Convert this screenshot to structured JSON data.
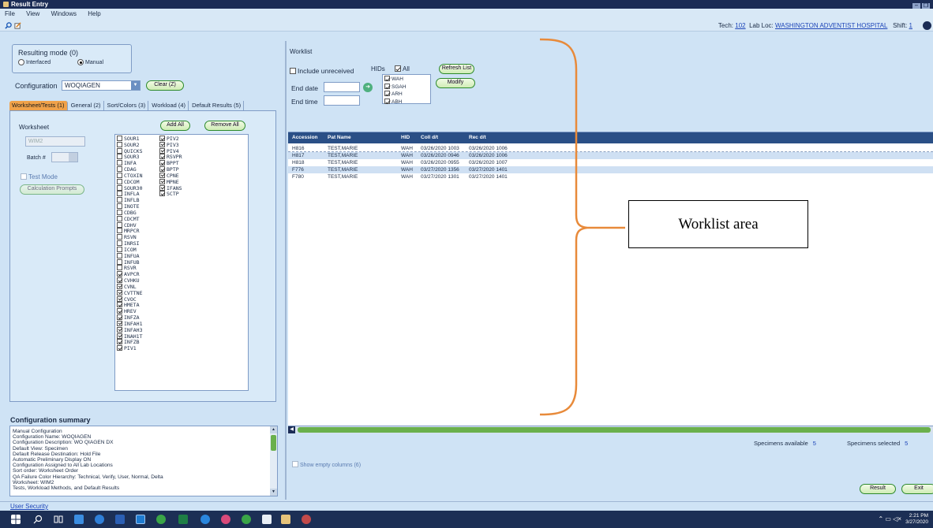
{
  "window": {
    "title": "Result Entry"
  },
  "menu": [
    "File",
    "View",
    "Windows",
    "Help"
  ],
  "toolbar": {
    "tech_label": "Tech:",
    "tech_value": "102",
    "lab_label": "Lab Loc:",
    "lab_value": "WASHINGTON ADVENTIST HOSPITAL",
    "shift_label": "Shift:",
    "shift_value": "1"
  },
  "resulting_mode": {
    "title": "Resulting mode (0)",
    "options": [
      "Interfaced",
      "Manual"
    ],
    "selected": "Manual"
  },
  "configuration": {
    "label": "Configuration",
    "value": "WOQIAGEN",
    "clear_label": "Clear (Z)"
  },
  "tabs": [
    "Worksheet/Tests (1)",
    "General (2)",
    "Sort/Colors (3)",
    "Workload (4)",
    "Default Results (5)"
  ],
  "worksheet": {
    "label": "Worksheet",
    "value": "WIM2",
    "batch_label": "Batch #",
    "test_mode_label": "Test Mode",
    "calc_label": "Calculation Prompts",
    "add_all_label": "Add All",
    "remove_all_label": "Remove All"
  },
  "tests_col1": [
    {
      "name": "SOUR1",
      "checked": false
    },
    {
      "name": "SOUR2",
      "checked": false
    },
    {
      "name": "QUICKS",
      "checked": false
    },
    {
      "name": "SOUR3",
      "checked": false
    },
    {
      "name": "INFA",
      "checked": false
    },
    {
      "name": "CDAG",
      "checked": false
    },
    {
      "name": "CTOXIN",
      "checked": false
    },
    {
      "name": "CDCOM",
      "checked": false
    },
    {
      "name": "SOUR30",
      "checked": false
    },
    {
      "name": "INFLA",
      "checked": false
    },
    {
      "name": "INFLB",
      "checked": false
    },
    {
      "name": "INOTE",
      "checked": false
    },
    {
      "name": "CDBG",
      "checked": false
    },
    {
      "name": "CDCMT",
      "checked": false
    },
    {
      "name": "CDHV",
      "checked": false
    },
    {
      "name": "MRPCR",
      "checked": false
    },
    {
      "name": "RSVN",
      "checked": false
    },
    {
      "name": "INRSI",
      "checked": false
    },
    {
      "name": "ICOM",
      "checked": false
    },
    {
      "name": "INFUA",
      "checked": false
    },
    {
      "name": "INFUB",
      "checked": false
    },
    {
      "name": "RSVR",
      "checked": false
    },
    {
      "name": "AVPCR",
      "checked": true
    },
    {
      "name": "CVHKU",
      "checked": true
    },
    {
      "name": "CVNL",
      "checked": true
    },
    {
      "name": "CVTTNE",
      "checked": true
    },
    {
      "name": "CVOC",
      "checked": true
    },
    {
      "name": "HMETA",
      "checked": true
    },
    {
      "name": "HREV",
      "checked": true
    },
    {
      "name": "INFZA",
      "checked": true
    },
    {
      "name": "INFAH1",
      "checked": true
    },
    {
      "name": "INFAH3",
      "checked": true
    },
    {
      "name": "INAH1T",
      "checked": true
    },
    {
      "name": "INFZB",
      "checked": true
    },
    {
      "name": "PIV1",
      "checked": true
    }
  ],
  "tests_col2": [
    {
      "name": "PIV2",
      "checked": true
    },
    {
      "name": "PIV3",
      "checked": true
    },
    {
      "name": "PIV4",
      "checked": true
    },
    {
      "name": "RSVPR",
      "checked": true
    },
    {
      "name": "BPPT",
      "checked": true
    },
    {
      "name": "BPTP",
      "checked": true
    },
    {
      "name": "CPNE",
      "checked": true
    },
    {
      "name": "MPNE",
      "checked": true
    },
    {
      "name": "IFANS",
      "checked": true
    },
    {
      "name": "SCTP",
      "checked": true
    }
  ],
  "summary": {
    "title": "Configuration summary",
    "lines": [
      "Manual Configuration",
      "Configuration Name: WOQIAGEN",
      "Configuration Description: WO QIAGEN DX",
      "Default View: Specimen",
      "Default Release Destination: Hold File",
      "Automatic Preliminary Display ON",
      "Configuration Assigned to All Lab Locations",
      "Sort order: Worksheet Order",
      "QA Failure Color Hierarchy: Technical, Verify, User, Normal, Delta",
      "Worksheet: WIM2",
      "Tests, Workload Methods, and Default Results"
    ]
  },
  "worklist": {
    "label": "Worklist",
    "include_unreceived": "Include unreceived",
    "hids_label": "HIDs",
    "hids_all": "All",
    "hids": [
      "WAH",
      "SGAH",
      "ARH",
      "ABH"
    ],
    "refresh_label": "Refresh List",
    "modify_label": "Modify",
    "end_date_label": "End date",
    "end_time_label": "End time"
  },
  "grid": {
    "headers": [
      "Accession",
      "Pat Name",
      "HID",
      "Coll d/t",
      "Rec d/t"
    ],
    "rows": [
      [
        "H816",
        "TEST,MARIE",
        "WAH",
        "03/26/2020 1003",
        "03/26/2020 1006"
      ],
      [
        "H817",
        "TEST,MARIE",
        "WAH",
        "03/26/2020 0946",
        "03/26/2020 1006"
      ],
      [
        "H818",
        "TEST,MARIE",
        "WAH",
        "03/26/2020 0955",
        "03/26/2020 1007"
      ],
      [
        "F776",
        "TEST,MARIE",
        "WAH",
        "03/27/2020 1356",
        "03/27/2020 1401"
      ],
      [
        "F780",
        "TEST,MARIE",
        "WAH",
        "03/27/2020 1301",
        "03/27/2020 1401"
      ]
    ]
  },
  "footer": {
    "avail_label": "Specimens available",
    "avail_value": "5",
    "selected_label": "Specimens selected",
    "selected_value": "5",
    "show_empty_label": "Show empty columns (6)",
    "result_label": "Result",
    "exit_label": "Exit",
    "user_security": "User Security"
  },
  "taskbar": {
    "time": "2:21 PM",
    "date": "3/27/2020"
  },
  "annotation": {
    "text": "Worklist area"
  },
  "colors": {
    "accent": "#f0a24a",
    "button_border": "#2d8a2d",
    "grid_header": "#2a4f86",
    "bracket": "#e88a3a"
  }
}
